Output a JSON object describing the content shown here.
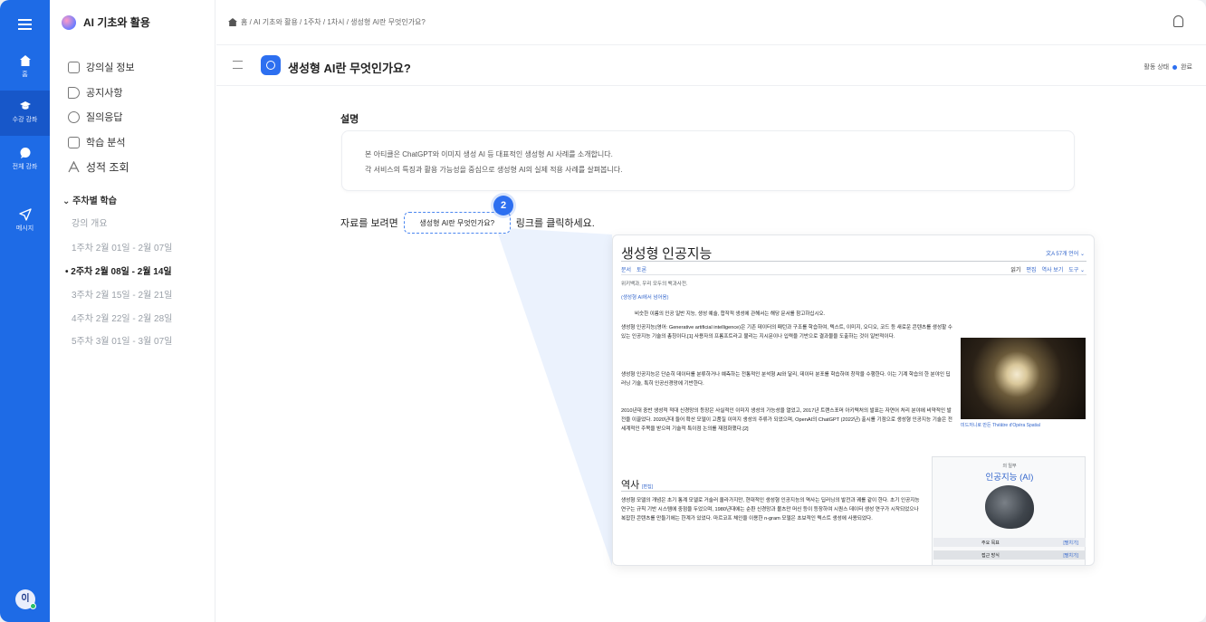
{
  "rail": {
    "items": [
      {
        "label": "홈"
      },
      {
        "label": "수강 강좌"
      },
      {
        "label": "전체 강좌"
      },
      {
        "label": "메시지"
      }
    ],
    "avatar": "이"
  },
  "sidebar": {
    "course_title": "AI 기초와 활용",
    "menu": [
      {
        "label": "강의실 정보"
      },
      {
        "label": "공지사항"
      },
      {
        "label": "질의응답"
      },
      {
        "label": "학습 분석"
      },
      {
        "label": "성적 조회"
      }
    ],
    "weeks_header": "주차별 학습",
    "weeks": [
      {
        "label": "강의 개요"
      },
      {
        "label": "1주차 2월 01일 - 2월 07일"
      },
      {
        "label": "2주차 2월 08일 - 2월 14일"
      },
      {
        "label": "3주차 2월 15일 - 2월 21일"
      },
      {
        "label": "4주차 2월 22일 - 2월 28일"
      },
      {
        "label": "5주차 3월 01일 - 3월 07일"
      }
    ]
  },
  "topbar": {
    "breadcrumb": "홈 / AI 기초와 활용 / 1주차 / 1차시 / 생성형 AI란 무엇인가요?"
  },
  "titlebar": {
    "title": "생성형 AI란 무엇인가요?",
    "status_label": "활동 상태",
    "status_value": "완료"
  },
  "main": {
    "section_label": "설명",
    "description": [
      "본 아티클은 ChatGPT와 이미지 생성 AI 등 대표적인 생성형 AI 사례를 소개합니다.",
      "각 서비스의 특징과 활용 가능성을 중심으로 생성형 AI의 실제 적용 사례를 살펴봅니다."
    ],
    "instruction_pre": "자료를 보려면",
    "link_label": "생성형 AI란 무엇인가요?",
    "instruction_post": "링크를 클릭하세요.",
    "step_number": "2"
  },
  "wiki": {
    "title": "생성형 인공지능",
    "lang": "文A 57개 언어 ⌄",
    "tabs_left": [
      "문서",
      "토론"
    ],
    "tabs_right": [
      "읽기",
      "편집",
      "역사 보기",
      "도구 ⌄"
    ],
    "from": "위키백과, 우리 모두의 백과사전.",
    "redirect": "(생성형 AI에서 넘어옴)",
    "hatnote": "비슷한 이름의 인공 일반 지능, 생성 예술, 합작적 생성에 관해서는 해당 문서를 참고하십시오.",
    "para1": "생성형 인공지능(영어: Generative artificial intelligence)은 기존 데이터의 패턴과 구조를 학습하여, 텍스트, 이미지, 오디오, 코드 등 새로운 콘텐츠를 생성할 수 있는 인공지능 기술의 총칭이다.[1] 사용자의 프롬프트라고 불리는 지시문이나 입력을 기반으로 결과물을 도출하는 것이 일반적이다.",
    "para2": "생성형 인공지능은 단순히 데이터를 분류하거나 예측하는 전통적인 분석형 AI와 달리, 데이터 분포를 학습하여 창작을 수행한다. 이는 기계 학습의 한 분야인 딥러닝 기술, 특히 인공신경망에 기반한다.",
    "para3": "2010년대 중반 생성적 적대 신경망의 등장은 사실적인 이미지 생성의 가능성을 열었고, 2017년 트랜스포머 아키텍처의 발표는 자연어 처리 분야에 비약적인 발전을 이끌었다. 2020년대 들어 확산 모델이 고품질 이미지 생성의 주류가 되었으며, OpenAI의 ChatGPT (2022년) 출시를 기점으로 생성형 인공지능 기술은 전 세계적인 주목을 받으며 기술적 특이점 논의를 재점화했다.[2]",
    "image_caption": "미드저니로 만든 Théâtre d'Opéra Spatial",
    "history_heading": "역사",
    "history_edit": "[편집]",
    "para4": "생성형 모델의 개념은 초기 통계 모델로 거슬러 올라가지만, 현대적인 생성형 인공지능의 역사는 딥러닝의 발전과 궤를 같이 한다. 초기 인공지능 연구는 규칙 기반 시스템에 중점을 두었으며, 1980년대에는 순환 신경망과 볼츠만 머신 등이 등장하여 시퀀스 데이터 생성 연구가 시작되었으나 복잡한 콘텐츠를 만들기에는 한계가 있었다. 마르코프 체인을 이용한 n-gram 모델은 초보적인 텍스트 생성에 사용되었다.",
    "infobox_sub": "의 일부",
    "infobox_title": "인공지능 (AI)",
    "infobox_rows": [
      {
        "k": "주요 목표",
        "v": "[펼치기]"
      },
      {
        "k": "접근 방식",
        "v": "[펼치기]"
      }
    ]
  }
}
